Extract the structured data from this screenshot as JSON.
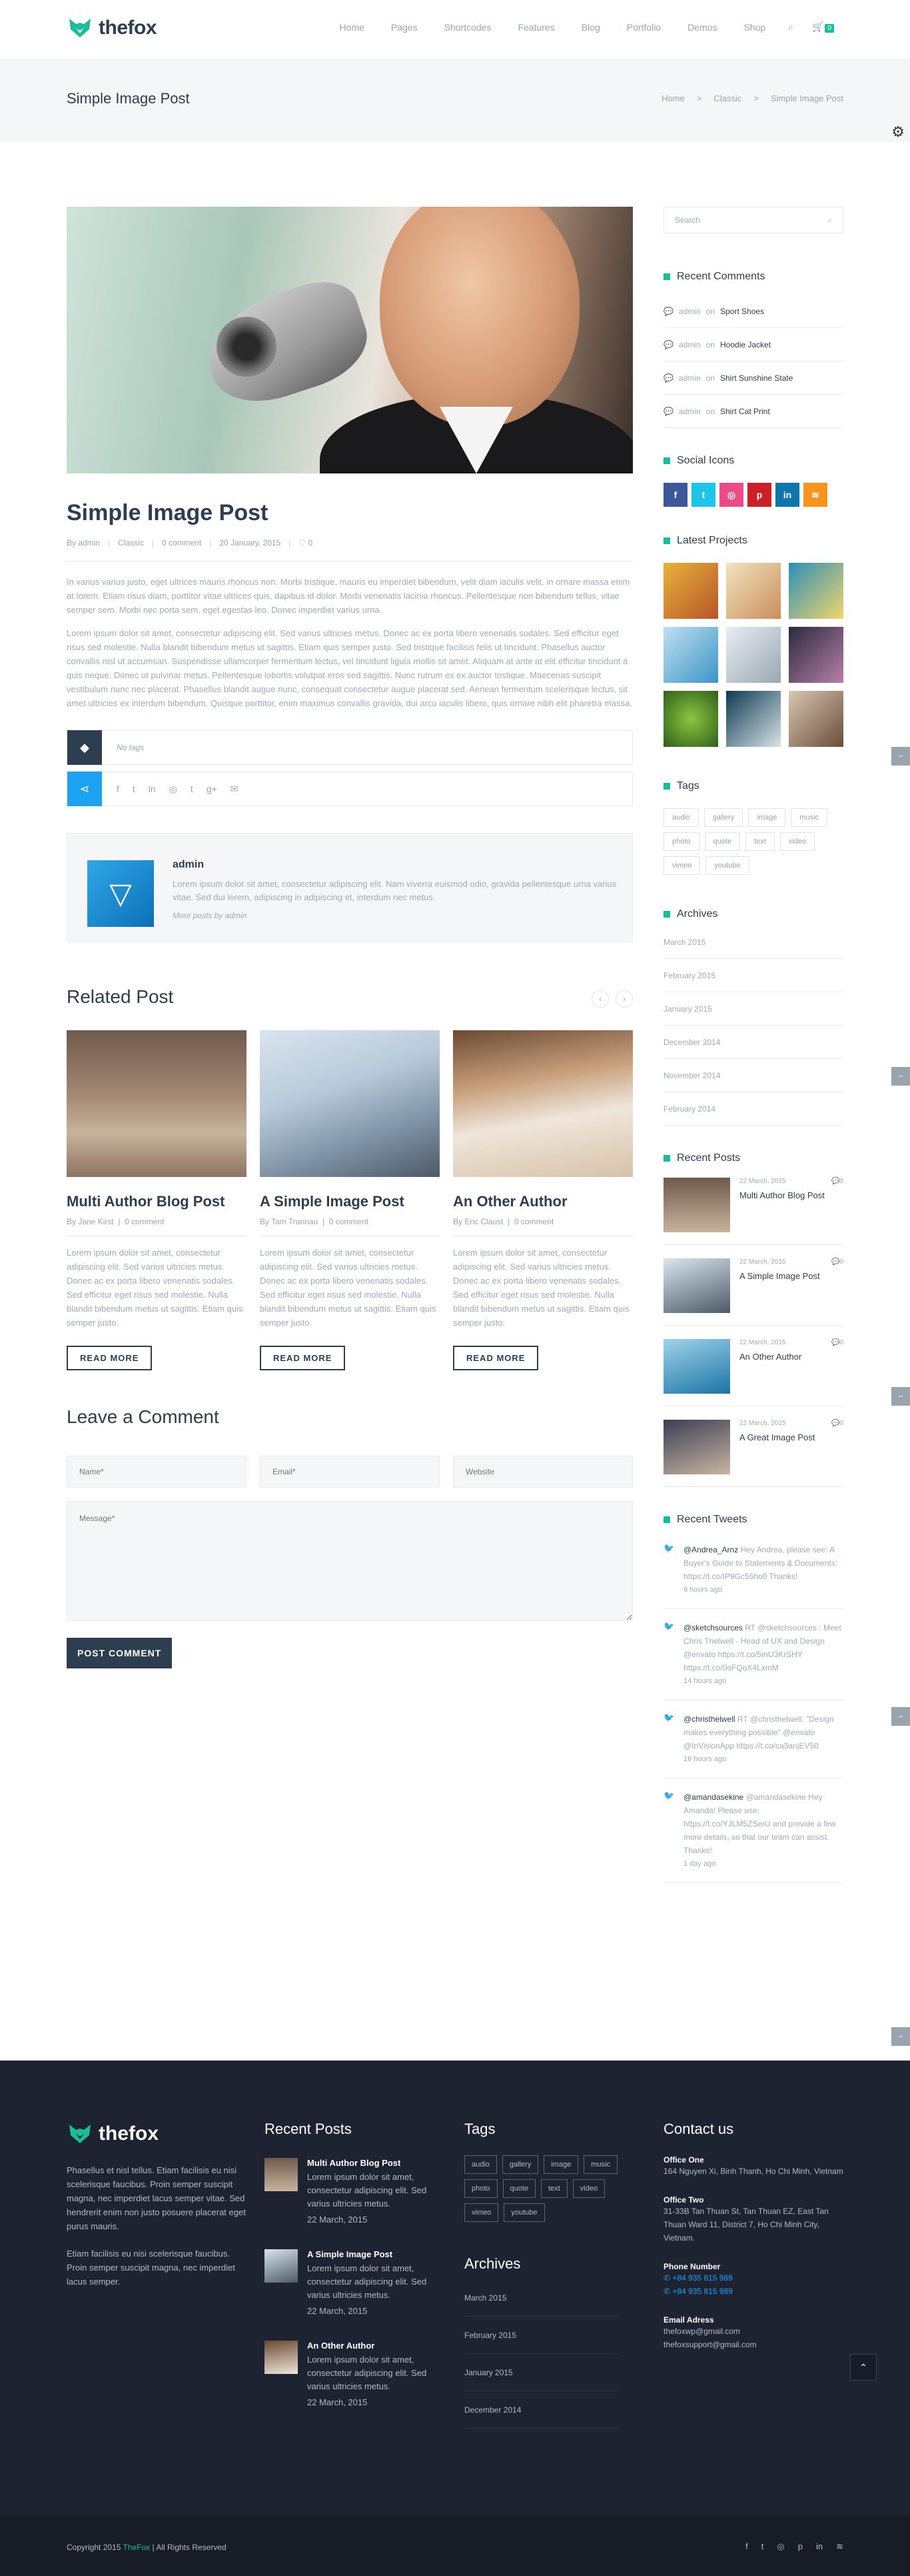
{
  "header": {
    "logo_text": "thefox",
    "nav": [
      "Home",
      "Pages",
      "Shortcodes",
      "Features",
      "Blog",
      "Portfolio",
      "Demos",
      "Shop"
    ],
    "cart_count": "0"
  },
  "titlebar": {
    "title": "Simple Image Post",
    "breadcrumbs": [
      "Home",
      "Classic",
      "Simple Image Post"
    ],
    "sep": ">"
  },
  "post": {
    "title": "Simple Image Post",
    "meta": {
      "author": "By admin",
      "category": "Classic",
      "comments": "0 comment",
      "date": "20 January, 2015",
      "likes": "0"
    },
    "para1": "In varius varius justo, eget ultrices mauris rhoncus non. Morbi tristique, mauris eu imperdiet bibendum, velit diam iaculis velit, in ornare massa enim at lorem. Etiam risus diam, porttitor vitae ultrices quis, dapibus id dolor. Morbi venenatis lacinia rhoncus. Pellentesque non bibendum tellus, vitae semper sem. Morbi nec porta sem, eget egestas leo. Donec imperdiet varius urna.",
    "para2": "Lorem ipsum dolor sit amet, consectetur adipiscing elit. Sed varius ultricies metus. Donec ac ex porta libero venenatis sodales. Sed efficitur eget risus sed molestie. Nulla blandit bibendum metus ut sagittis. Etiam quis semper justo. Sed tristique facilisis felis ut tincidunt. Phasellus auctor convallis nisl ut accumsan. Suspendisse ullamcorper fermentum lectus, vel tincidunt ligula mollis sit amet. Aliquam at ante at elit efficitur tincidunt a quis neque. Donec ut pulvinar metus. Pellentesque lobortis volutpat eros sed sagittis. Nunc rutrum ex ex auctor tristique. Maecenas suscipit vestibulum nunc nec placerat. Phasellus blandit augue nunc, consequat consectetur augue placerat sed. Aenean fermentum scelerisque lectus, sit amet ultricies ex interdum bibendum. Quisque porttitor, enim maximus convallis gravida, dui arcu iaculis libero, quis ornare nibh elit pharetra massa.",
    "no_tags": "No tags"
  },
  "author": {
    "name": "admin",
    "bio": "Lorem ipsum dolor sit amet, consectetur adipiscing elit. Nam viverra euismod odio, gravida pellentesque urna varius vitae. Sed dui lorem, adipiscing in adipiscing et, interdum nec metus.",
    "more": "More posts by admin"
  },
  "related": {
    "heading": "Related Post",
    "items": [
      {
        "title": "Multi Author Blog Post",
        "author": "By Jane Kirst",
        "comments": "0 comment",
        "text": "Lorem ipsum dolor sit amet, consectetur adipiscing elit. Sed varius ultricies metus. Donec ac ex porta libero venenatis sodales. Sed efficitur eget risus sed molestie. Nulla blandit bibendum metus ut sagittis. Etiam quis semper justo.",
        "button": "READ MORE"
      },
      {
        "title": "A Simple Image Post",
        "author": "By Tam Trannau",
        "comments": "0 comment",
        "text": "Lorem ipsum dolor sit amet, consectetur adipiscing elit. Sed varius ultricies metus. Donec ac ex porta libero venenatis sodales. Sed efficitur eget risus sed molestie. Nulla blandit bibendum metus ut sagittis. Etiam quis semper justo.",
        "button": "READ MORE"
      },
      {
        "title": "An Other Author",
        "author": "By Eric Claust",
        "comments": "0 comment",
        "text": "Lorem ipsum dolor sit amet, consectetur adipiscing elit. Sed varius ultricies metus. Donec ac ex porta libero venenatis sodales. Sed efficitur eget risus sed molestie. Nulla blandit bibendum metus ut sagittis. Etiam quis semper justo.",
        "button": "READ MORE"
      }
    ]
  },
  "comment_form": {
    "heading": "Leave a Comment",
    "name_placeholder": "Name*",
    "email_placeholder": "Email*",
    "website_placeholder": "Website",
    "message_placeholder": "Message*",
    "submit": "POST COMMENT"
  },
  "sidebar": {
    "search_placeholder": "Search",
    "recent_comments_title": "Recent Comments",
    "recent_comments": [
      {
        "who": "admin",
        "on": "on",
        "post": "Sport Shoes"
      },
      {
        "who": "admin",
        "on": "on",
        "post": "Hoodie Jacket"
      },
      {
        "who": "admin",
        "on": "on",
        "post": "Shirt Sunshine State"
      },
      {
        "who": "admin",
        "on": "on",
        "post": "Shirt Cat Print"
      }
    ],
    "social_title": "Social Icons",
    "social": [
      {
        "icon": "facebook-icon",
        "glyph": "f",
        "color": "#3b5998"
      },
      {
        "icon": "twitter-icon",
        "glyph": "t",
        "color": "#1dc6e8"
      },
      {
        "icon": "dribbble-icon",
        "glyph": "◎",
        "color": "#ea4c89"
      },
      {
        "icon": "pinterest-icon",
        "glyph": "p",
        "color": "#cb2027"
      },
      {
        "icon": "linkedin-icon",
        "glyph": "in",
        "color": "#0e76a8"
      },
      {
        "icon": "rss-icon",
        "glyph": "≋",
        "color": "#f7941d"
      }
    ],
    "projects_title": "Latest Projects",
    "tags_title": "Tags",
    "tags": [
      "audio",
      "gallery",
      "image",
      "music",
      "photo",
      "quote",
      "text",
      "video",
      "vimeo",
      "youtube"
    ],
    "archives_title": "Archives",
    "archives": [
      "March 2015",
      "February 2015",
      "January 2015",
      "December 2014",
      "November 2014",
      "February 2014"
    ],
    "recent_posts_title": "Recent Posts",
    "recent_posts": [
      {
        "date": "22 March, 2015",
        "comments": "0",
        "title": "Multi Author Blog Post"
      },
      {
        "date": "22 March, 2015",
        "comments": "0",
        "title": "A Simple Image Post"
      },
      {
        "date": "22 March, 2015",
        "comments": "0",
        "title": "An Other Author"
      },
      {
        "date": "22 March, 2015",
        "comments": "0",
        "title": "A Great Image Post"
      }
    ],
    "tweets_title": "Recent Tweets",
    "tweets": [
      {
        "handle": "@Andrea_Arnz",
        "text": "Hey Andrea, please see: A Buyer's Guide to Statements & Documents: https://t.co/IP9Gc55ho0 Thanks!",
        "time": "9 hours ago"
      },
      {
        "handle": "@sketchsources",
        "text": "RT @sketchsources : Meet Chris Thelwell - Head of UX and Design @envato https://t.co/5mU3KrSHY https://t.co/0oFQoX4LxmM",
        "time": "14 hours ago"
      },
      {
        "handle": "@christhelwell",
        "text": "RT @christhelwell: \"Design makes everything possible\" @envato @InVisionApp https://t.co/ca3anjEV50",
        "time": "16 hours ago"
      },
      {
        "handle": "@amandasekine",
        "text": "@amandasekine Hey Amanda! Please use: https://t.co/YJLM5ZSerU and provide a few more details, so that our team can assist. Thanks!",
        "time": "1 day ago"
      }
    ]
  },
  "footer": {
    "logo_text": "thefox",
    "about1": "Phasellus et nisl tellus. Etiam facilisis eu nisi scelerisque faucibus. Proin semper suscipit magna, nec imperdiet lacus semper vitae. Sed hendrerit enim non justo posuere placerat eget purus mauris.",
    "about2": "Etiam facilisis eu nisi scelerisque faucibus. Proin semper suscipit magna, nec imperdiet lacus semper.",
    "recent_title": "Recent Posts",
    "recent": [
      {
        "title": "Multi Author Blog Post",
        "body": "Lorem ipsum dolor sit amet, consectetur adipiscing elit. Sed varius ultricies metus.",
        "date": "22 March, 2015"
      },
      {
        "title": "A Simple Image Post",
        "body": "Lorem ipsum dolor sit amet, consectetur adipiscing elit. Sed varius ultricies metus.",
        "date": "22 March, 2015"
      },
      {
        "title": "An Other Author",
        "body": "Lorem ipsum dolor sit amet, consectetur adipiscing elit. Sed varius ultricies metus.",
        "date": "22 March, 2015"
      }
    ],
    "tags_title": "Tags",
    "tags": [
      "audio",
      "gallery",
      "image",
      "music",
      "photo",
      "quote",
      "text",
      "video",
      "vimeo",
      "youtube"
    ],
    "archives_title": "Archives",
    "archives": [
      "March 2015",
      "February 2015",
      "January 2015",
      "December 2014"
    ],
    "contact_title": "Contact us",
    "office1_label": "Office One",
    "office1": "164 Nguyen Xi, Binh Thanh, Ho Chi Minh, Vietnam",
    "office2_label": "Office Two",
    "office2": "31-33B Tan Thuan St, Tan Thuan EZ, East Tan Thuan Ward 11, District 7, Ho Chi Minh City, Vietnam.",
    "phone_label": "Phone Number",
    "phones": [
      "+84 935 815 989",
      "+84 935 815 989"
    ],
    "email_label": "Email Adress",
    "emails": [
      "thefoxwp@gmail.com",
      "thefoxsupport@gmail.com"
    ]
  },
  "bottom": {
    "copy_pre": "Copyright 2015",
    "copy_brand": "TheFox",
    "copy_post": "| All Rights Reserved"
  },
  "colors": {
    "accent": "#1abc9c",
    "dark": "#2c3e50",
    "footer": "#1d2331"
  }
}
